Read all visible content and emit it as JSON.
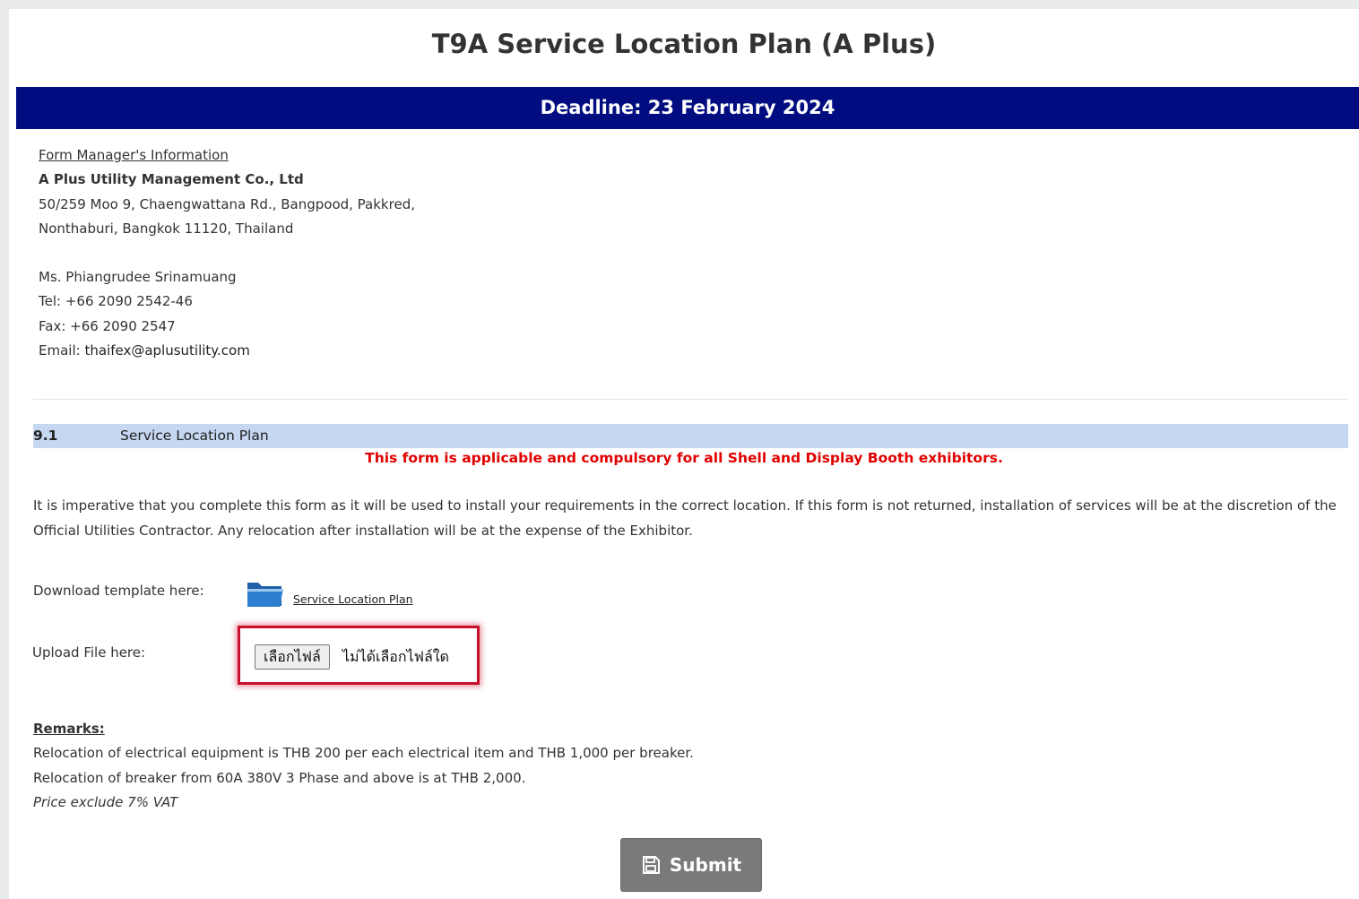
{
  "page": {
    "title": "T9A Service Location Plan (A Plus)",
    "deadline": "Deadline: 23 February 2024"
  },
  "manager": {
    "heading": "Form Manager's Information",
    "company": "A Plus Utility Management Co., Ltd",
    "address_line1": "50/259 Moo 9, Chaengwattana Rd., Bangpood, Pakkred,",
    "address_line2": "Nonthaburi, Bangkok 11120, Thailand",
    "contact_name": "Ms. Phiangrudee Srinamuang",
    "tel": "Tel: +66 2090 2542-46",
    "fax": "Fax: +66 2090 2547",
    "email_label": "Email: ",
    "email_value": "thaifex@aplusutility.com"
  },
  "section": {
    "number": "9.1",
    "title": "Service Location Plan",
    "notice": "This form is applicable and compulsory for all Shell and Display Booth exhibitors.",
    "description": "It is imperative that you complete this form as it will be used to install your requirements in the correct location. If this form is not returned, installation of services will be at the discretion of the Official Utilities Contractor. Any relocation after installation will be at the expense of the Exhibitor."
  },
  "download": {
    "label": "Download template here:",
    "icon": "folder-icon",
    "link_text": "Service Location Plan"
  },
  "upload": {
    "label": "Upload File here:",
    "button_label": "เลือกไฟล์",
    "status": "ไม่ได้เลือกไฟล์ใด",
    "highlight_color": "#c8102e"
  },
  "remarks": {
    "heading": "Remarks:",
    "line1": "Relocation of electrical equipment is THB 200 per each electrical item and THB 1,000 per breaker.",
    "line2": "Relocation of breaker from 60A 380V 3 Phase and above is at THB 2,000.",
    "line3": "Price exclude 7% VAT"
  },
  "submit": {
    "label": "Submit",
    "icon": "save-icon"
  },
  "colors": {
    "deadline_bar": "#000c80",
    "section_bar": "#c5d7f1",
    "notice_text": "#e00000",
    "submit_button": "#7a7a7a"
  }
}
